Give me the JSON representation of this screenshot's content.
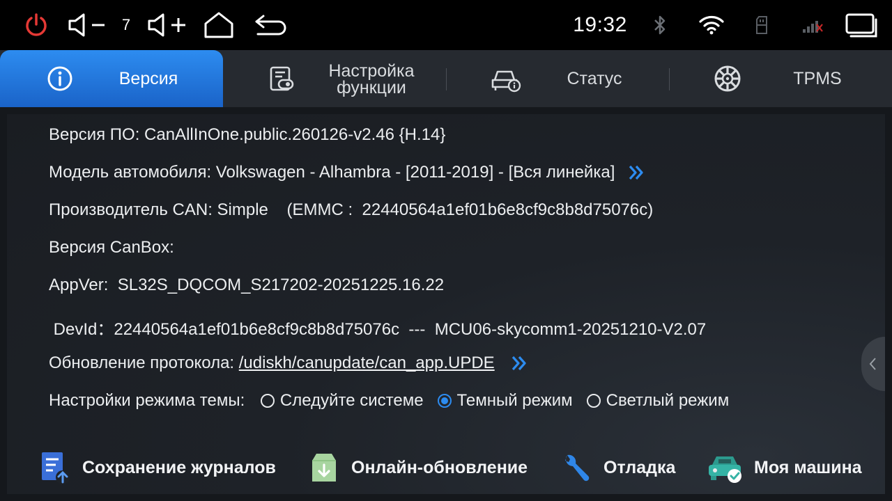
{
  "statusbar": {
    "volume_level": "7",
    "time": "19:32"
  },
  "tabs": [
    {
      "label": "Версия",
      "icon": "info-icon",
      "active": true
    },
    {
      "label_line1": "Настройка",
      "label_line2": "функции",
      "icon": "function-settings-icon"
    },
    {
      "label": "Статус",
      "icon": "car-status-icon"
    },
    {
      "label": "TPMS",
      "icon": "tire-icon"
    }
  ],
  "info": {
    "software_version": "Версия ПО: CanAllInOne.public.260126-v2.46 {H.14}",
    "car_model": "Модель автомобиля: Volkswagen - Alhambra - [2011-2019] - [Вся линейка]",
    "can_manufacturer": "Производитель CAN: Simple    (EMMC :  22440564a1ef01b6e8cf9c8b8d75076c)",
    "canbox_version": "Версия CanBox:",
    "app_ver": "AppVer:  SL32S_DQCOM_S217202-20251225.16.22",
    "dev_id": " DevId：22440564a1ef01b6e8cf9c8b8d75076c  ---  MCU06-skycomm1-20251210-V2.07",
    "protocol_update_label": "Обновление протокола: ",
    "protocol_update_path": "/udiskh/canupdate/can_app.UPDE",
    "theme_label": "Настройки режима темы: ",
    "theme_options": [
      "Следуйте системе",
      "Темный режим",
      "Светлый режим"
    ],
    "theme_selected": "Темный режим"
  },
  "actions": [
    {
      "label": "Сохранение журналов",
      "icon": "save-logs-icon"
    },
    {
      "label": "Онлайн-обновление",
      "icon": "online-update-icon"
    },
    {
      "label": "Отладка",
      "icon": "wrench-icon"
    },
    {
      "label": "Моя машина",
      "icon": "my-car-icon"
    }
  ],
  "colors": {
    "accent": "#2d8cf0",
    "power": "#e53935",
    "background": "#15181c"
  }
}
